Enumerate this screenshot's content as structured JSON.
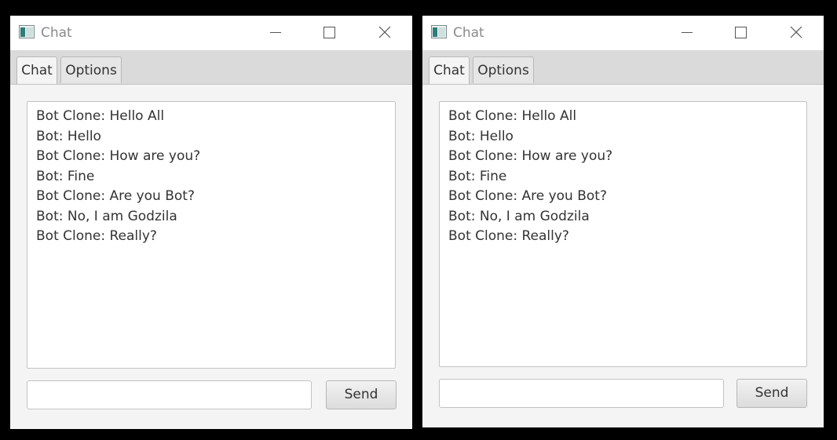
{
  "windows": [
    {
      "title": "Chat",
      "tabs": [
        {
          "label": "Chat",
          "active": true
        },
        {
          "label": "Options",
          "active": false
        }
      ],
      "messages": [
        "Bot Clone: Hello All",
        "Bot: Hello",
        "Bot Clone: How are you?",
        "Bot: Fine",
        "Bot Clone: Are you Bot?",
        "Bot: No, I am Godzila",
        "Bot Clone: Really?"
      ],
      "input_value": "",
      "send_label": "Send"
    },
    {
      "title": "Chat",
      "tabs": [
        {
          "label": "Chat",
          "active": true
        },
        {
          "label": "Options",
          "active": false
        }
      ],
      "messages": [
        "Bot Clone: Hello All",
        "Bot: Hello",
        "Bot Clone: How are you?",
        "Bot: Fine",
        "Bot Clone: Are you Bot?",
        "Bot: No, I am Godzila",
        "Bot Clone: Really?"
      ],
      "input_value": "",
      "send_label": "Send"
    }
  ],
  "icons": {
    "app": "app-window-icon",
    "minimize": "minimize-icon",
    "maximize": "maximize-icon",
    "close": "close-icon"
  },
  "colors": {
    "desktop_background": "#000000",
    "window_background": "#f4f4f4",
    "titlebar_background": "#ffffff",
    "tabbar_background": "#dadada",
    "text": "#333333"
  }
}
